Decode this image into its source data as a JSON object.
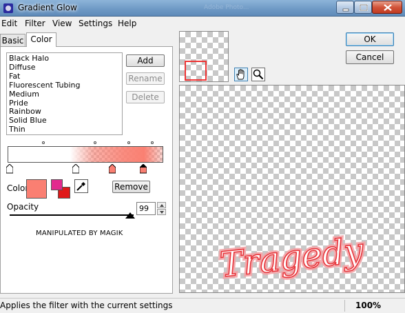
{
  "window": {
    "title": "Gradient Glow",
    "background_title": "Adobe Photo..."
  },
  "menu": [
    "Edit",
    "Filter",
    "View",
    "Settings",
    "Help"
  ],
  "tabs": [
    {
      "label": "Basic",
      "active": false
    },
    {
      "label": "Color",
      "active": true
    }
  ],
  "presets": [
    "Black Halo",
    "Diffuse",
    "Fat",
    "Fluorescent Tubing",
    "Medium",
    "Pride",
    "Rainbow",
    "Solid Blue",
    "Thin"
  ],
  "buttons": {
    "add": "Add",
    "rename": "Rename",
    "delete": "Delete",
    "ok": "OK",
    "cancel": "Cancel",
    "remove": "Remove"
  },
  "color": {
    "label": "Color",
    "selected": "#fa7f72",
    "primary": "#e3298e",
    "secondary": "#e01919"
  },
  "opacity": {
    "label": "Opacity",
    "value": "99",
    "slider_fraction": 0.99
  },
  "credit": "MANIPULATED BY MAGIK",
  "preview": {
    "text": "Tragedy",
    "text_color": "#e8353b"
  },
  "status": {
    "text": "Applies the filter with the current settings",
    "zoom": "100%"
  },
  "icons": [
    "app-icon",
    "minimize-icon",
    "maximize-icon",
    "close-icon",
    "eyedropper-icon",
    "hand-icon",
    "zoom-icon",
    "spin-up-icon",
    "spin-down-icon"
  ]
}
